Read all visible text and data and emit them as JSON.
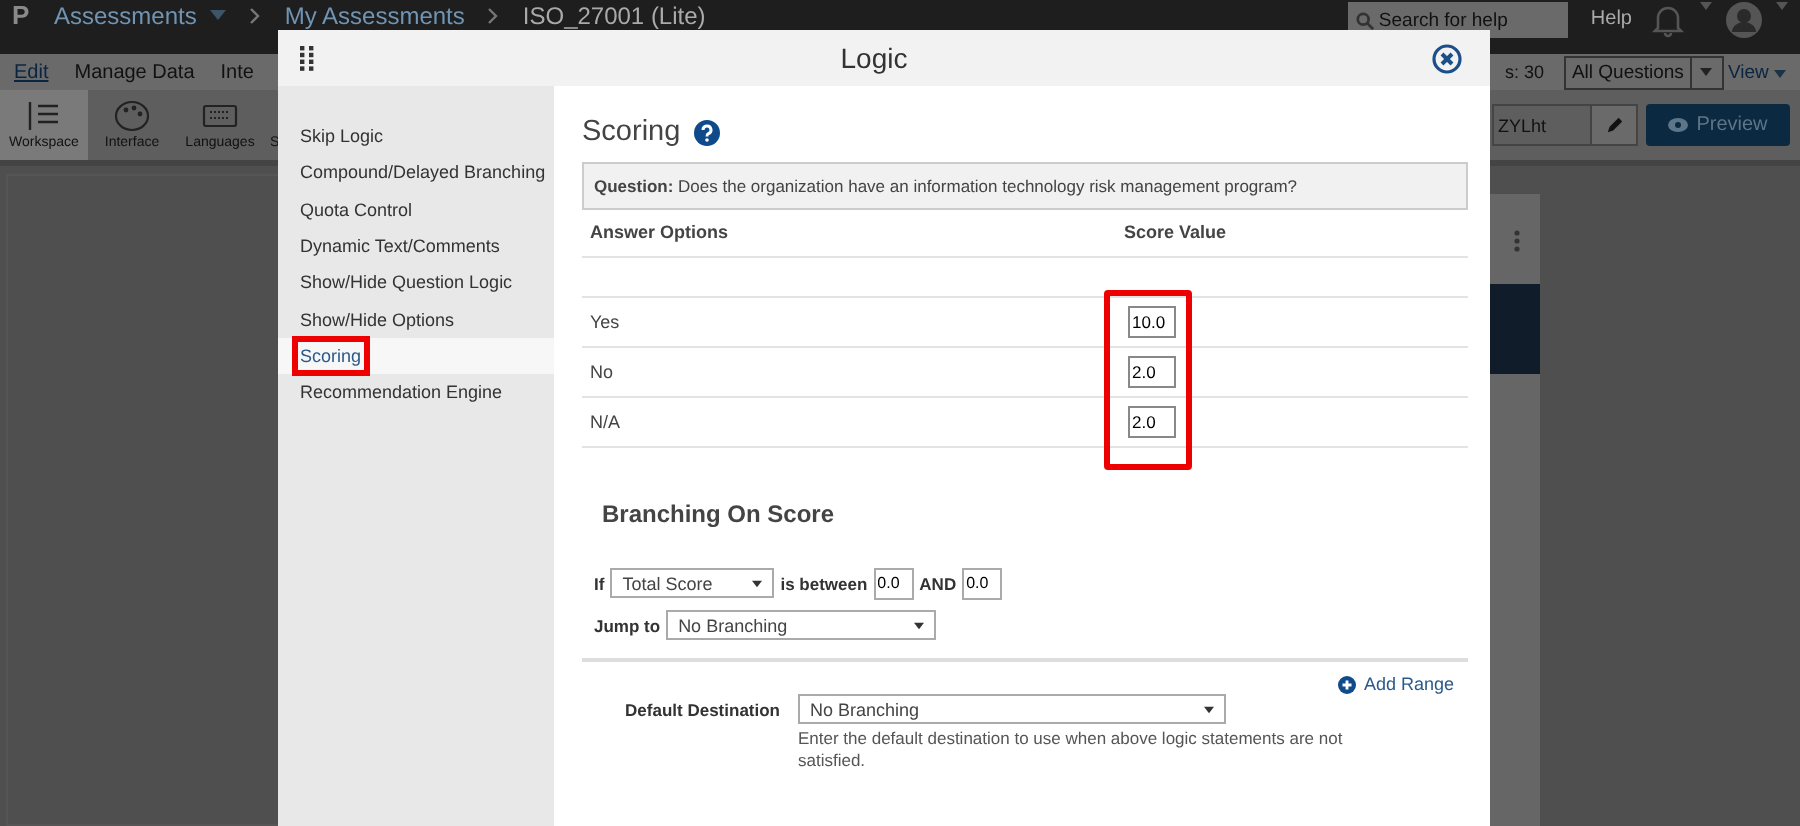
{
  "app_bar": {
    "logo": "P",
    "breadcrumbs": [
      "Assessments",
      "My Assessments",
      "ISO_27001 (Lite)"
    ],
    "search": {
      "placeholder": "Search for help"
    },
    "help": "Help"
  },
  "menu": [
    {
      "label": "Edit",
      "selected": true
    },
    {
      "label": "Manage Data",
      "selected": false
    },
    {
      "label": "Inte",
      "selected": false
    }
  ],
  "toolbar": [
    {
      "label": "Workspace",
      "kind": "workspace",
      "selected": true
    },
    {
      "label": "Interface",
      "kind": "palette",
      "selected": false
    },
    {
      "label": "Languages",
      "kind": "keyboard",
      "selected": false
    },
    {
      "label": "S",
      "kind": "none",
      "selected": false
    }
  ],
  "right_bar": {
    "count": "s: 30",
    "filter": "All Questions",
    "view": "View",
    "name_field": "ZYLht",
    "preview": "Preview"
  },
  "modal": {
    "title": "Logic",
    "sidebar": [
      {
        "label": "Skip Logic",
        "selected": false,
        "highlighted": false
      },
      {
        "label": "Compound/Delayed Branching",
        "selected": false,
        "highlighted": false
      },
      {
        "label": "Quota Control",
        "selected": false,
        "highlighted": false
      },
      {
        "label": "Dynamic Text/Comments",
        "selected": false,
        "highlighted": false
      },
      {
        "label": "Show/Hide Question Logic",
        "selected": false,
        "highlighted": false
      },
      {
        "label": "Show/Hide Options",
        "selected": false,
        "highlighted": false
      },
      {
        "label": "Scoring",
        "selected": true,
        "highlighted": true
      },
      {
        "label": "Recommendation Engine",
        "selected": false,
        "highlighted": false
      }
    ],
    "heading": "Scoring",
    "question": "**Question:** Does the organization have an information technology risk management program?",
    "columns": [
      "Answer Options",
      "Score Value"
    ],
    "rows": [
      {
        "answer": "Yes",
        "score": "10.0"
      },
      {
        "answer": "No",
        "score": "2.0"
      },
      {
        "answer": "N/A",
        "score": "2.0"
      }
    ],
    "scores_highlighted": true,
    "branching": {
      "title": "Branching On Score",
      "if_label": "If",
      "metric": "Total Score",
      "between_label": "is between",
      "from": "0.0",
      "and_label": "AND",
      "to": "0.0",
      "jump_label": "Jump to",
      "jump_value": "No Branching",
      "add_range": "Add Range",
      "default_label": "Default Destination",
      "default_value": "No Branching",
      "default_help": "Enter the default destination to use when above logic statements are not satisfied."
    }
  }
}
